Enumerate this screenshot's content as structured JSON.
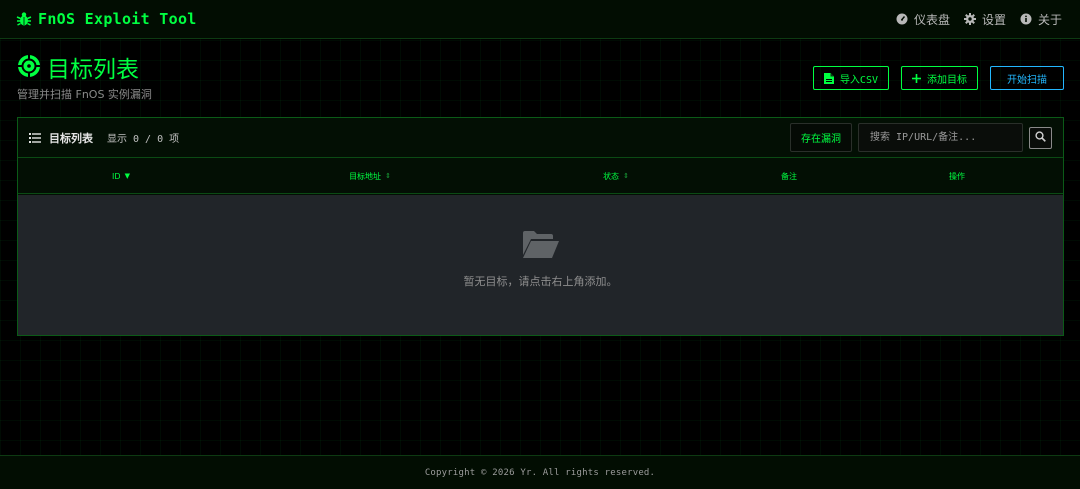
{
  "navbar": {
    "brand": "FnOS Exploit Tool",
    "brand_icon": "bug-icon",
    "links": [
      {
        "label": "仪表盘",
        "icon": "gauge-icon"
      },
      {
        "label": "设置",
        "icon": "gear-icon"
      },
      {
        "label": "关于",
        "icon": "info-icon"
      }
    ]
  },
  "page": {
    "title": "目标列表",
    "title_icon": "crosshairs-icon",
    "subtitle": "管理并扫描 FnOS 实例漏洞"
  },
  "actions": {
    "import_csv": "导入CSV",
    "add_target": "添加目标",
    "start_scan": "开始扫描"
  },
  "card": {
    "title": "目标列表",
    "count_text": "显示 0 / 0 项",
    "filter_label": "存在漏洞",
    "search_placeholder": "搜索 IP/URL/备注..."
  },
  "table": {
    "columns": [
      {
        "label": "ID",
        "sort": "desc"
      },
      {
        "label": "目标地址",
        "sort": "both"
      },
      {
        "label": "状态",
        "sort": "both"
      },
      {
        "label": "备注",
        "sort": "none"
      },
      {
        "label": "操作",
        "sort": "none"
      }
    ],
    "rows": [],
    "empty_text": "暂无目标，请点击右上角添加。"
  },
  "footer": {
    "text": "Copyright © 2026 Yr. All rights reserved."
  },
  "colors": {
    "accent": "#00ff41",
    "info": "#23b8ff",
    "background": "#000000",
    "panel": "#212529"
  }
}
